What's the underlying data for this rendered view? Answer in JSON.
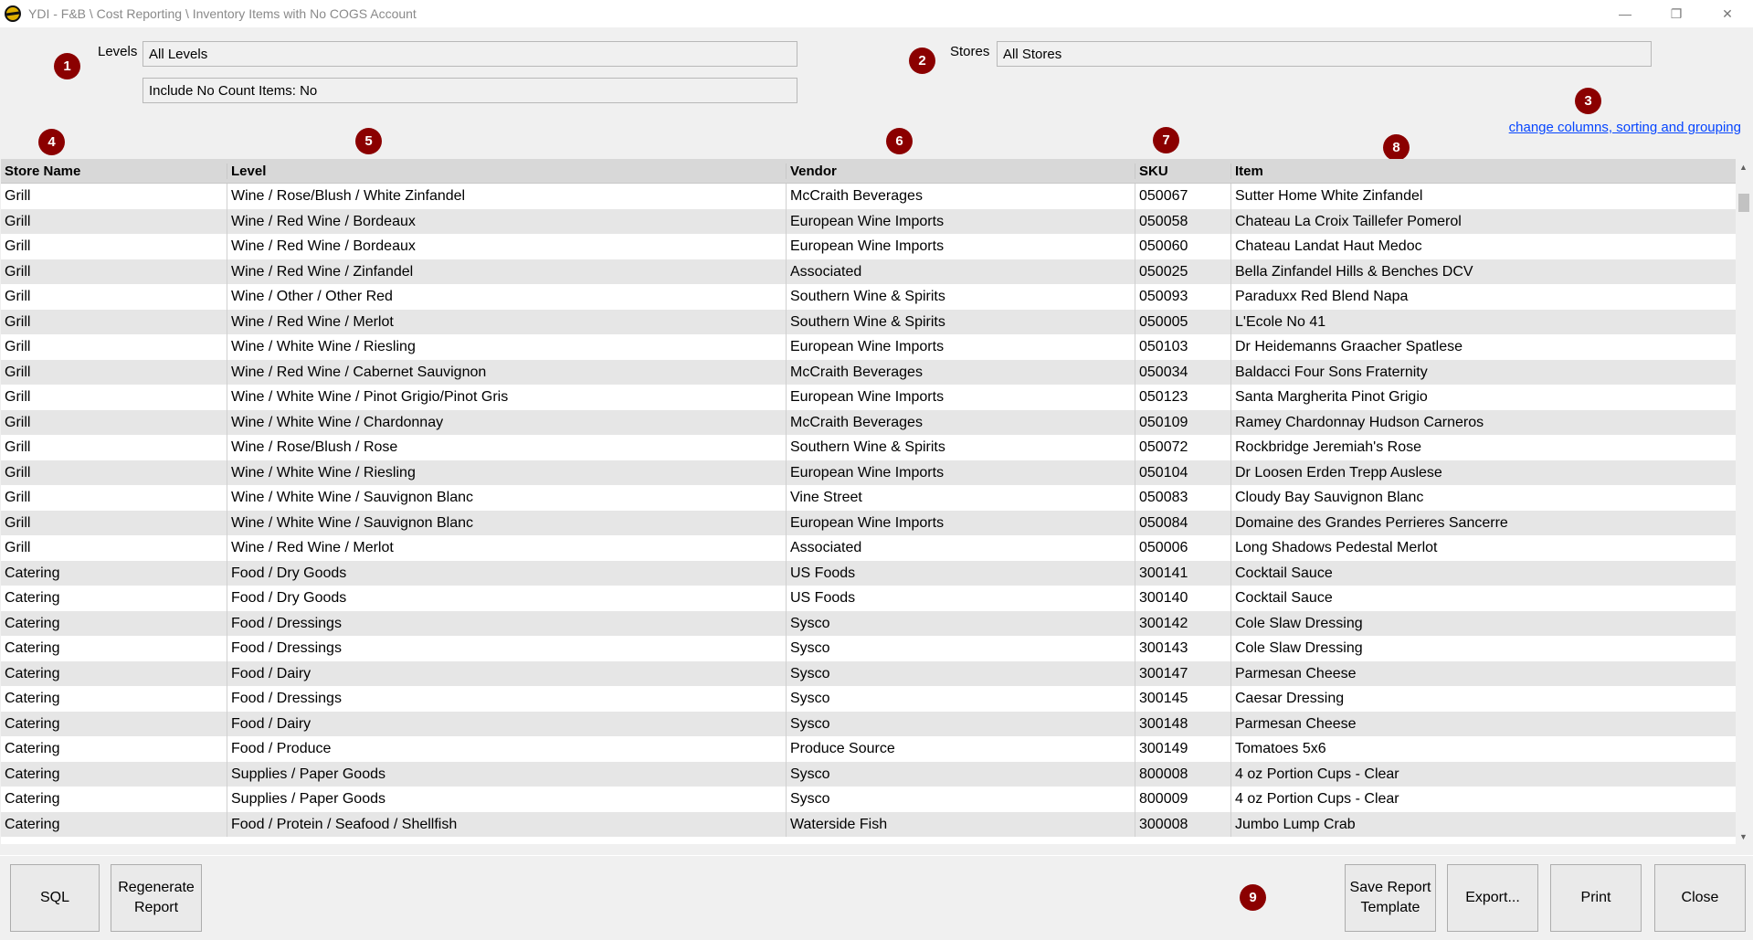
{
  "window": {
    "title": "YDI - F&B \\ Cost Reporting \\ Inventory Items with No COGS Account",
    "minimize_glyph": "—",
    "restore_glyph": "❐",
    "close_glyph": "✕"
  },
  "filters": {
    "levels_label": "Levels",
    "levels_value": "All Levels",
    "no_count_value": "Include No Count Items: No",
    "stores_label": "Stores",
    "stores_value": "All Stores"
  },
  "markers": [
    "1",
    "2",
    "3",
    "4",
    "5",
    "6",
    "7",
    "8",
    "9"
  ],
  "change_link": "change columns, sorting and grouping",
  "grid": {
    "headers": {
      "store": "Store Name",
      "level": "Level",
      "vendor": "Vendor",
      "sku": "SKU",
      "item": "Item"
    },
    "rows": [
      {
        "store": "Grill",
        "level": "Wine / Rose/Blush / White Zinfandel",
        "vendor": "McCraith Beverages",
        "sku": "050067",
        "item": "Sutter Home White Zinfandel"
      },
      {
        "store": "Grill",
        "level": "Wine / Red Wine / Bordeaux",
        "vendor": "European Wine Imports",
        "sku": "050058",
        "item": "Chateau La Croix Taillefer Pomerol"
      },
      {
        "store": "Grill",
        "level": "Wine / Red Wine / Bordeaux",
        "vendor": "European Wine Imports",
        "sku": "050060",
        "item": "Chateau Landat Haut Medoc"
      },
      {
        "store": "Grill",
        "level": "Wine / Red Wine / Zinfandel",
        "vendor": "Associated",
        "sku": "050025",
        "item": "Bella Zinfandel Hills & Benches DCV"
      },
      {
        "store": "Grill",
        "level": "Wine / Other / Other Red",
        "vendor": "Southern Wine & Spirits",
        "sku": "050093",
        "item": "Paraduxx  Red Blend Napa"
      },
      {
        "store": "Grill",
        "level": "Wine / Red Wine / Merlot",
        "vendor": "Southern Wine & Spirits",
        "sku": "050005",
        "item": "L'Ecole No 41"
      },
      {
        "store": "Grill",
        "level": "Wine / White Wine / Riesling",
        "vendor": "European Wine Imports",
        "sku": "050103",
        "item": "Dr Heidemanns Graacher Spatlese"
      },
      {
        "store": "Grill",
        "level": "Wine / Red Wine / Cabernet Sauvignon",
        "vendor": "McCraith Beverages",
        "sku": "050034",
        "item": "Baldacci Four Sons Fraternity"
      },
      {
        "store": "Grill",
        "level": "Wine / White Wine / Pinot Grigio/Pinot Gris",
        "vendor": "European Wine Imports",
        "sku": "050123",
        "item": "Santa Margherita Pinot Grigio"
      },
      {
        "store": "Grill",
        "level": "Wine / White Wine / Chardonnay",
        "vendor": "McCraith Beverages",
        "sku": "050109",
        "item": "Ramey Chardonnay Hudson Carneros"
      },
      {
        "store": "Grill",
        "level": "Wine / Rose/Blush / Rose",
        "vendor": "Southern Wine & Spirits",
        "sku": "050072",
        "item": "Rockbridge Jeremiah's Rose"
      },
      {
        "store": "Grill",
        "level": "Wine / White Wine / Riesling",
        "vendor": "European Wine Imports",
        "sku": "050104",
        "item": "Dr Loosen Erden Trepp Auslese"
      },
      {
        "store": "Grill",
        "level": "Wine / White Wine / Sauvignon Blanc",
        "vendor": "Vine Street",
        "sku": "050083",
        "item": "Cloudy Bay Sauvignon Blanc"
      },
      {
        "store": "Grill",
        "level": "Wine / White Wine / Sauvignon Blanc",
        "vendor": "European Wine Imports",
        "sku": "050084",
        "item": "Domaine des Grandes Perrieres Sancerre"
      },
      {
        "store": "Grill",
        "level": "Wine / Red Wine / Merlot",
        "vendor": "Associated",
        "sku": "050006",
        "item": "Long Shadows Pedestal Merlot"
      },
      {
        "store": "Catering",
        "level": "Food / Dry Goods",
        "vendor": "US Foods",
        "sku": "300141",
        "item": "Cocktail Sauce"
      },
      {
        "store": "Catering",
        "level": "Food / Dry Goods",
        "vendor": "US Foods",
        "sku": "300140",
        "item": "Cocktail Sauce"
      },
      {
        "store": "Catering",
        "level": "Food / Dressings",
        "vendor": "Sysco",
        "sku": "300142",
        "item": "Cole Slaw Dressing"
      },
      {
        "store": "Catering",
        "level": "Food / Dressings",
        "vendor": "Sysco",
        "sku": "300143",
        "item": "Cole Slaw Dressing"
      },
      {
        "store": "Catering",
        "level": "Food / Dairy",
        "vendor": "Sysco",
        "sku": "300147",
        "item": "Parmesan Cheese"
      },
      {
        "store": "Catering",
        "level": "Food / Dressings",
        "vendor": "Sysco",
        "sku": "300145",
        "item": "Caesar Dressing"
      },
      {
        "store": "Catering",
        "level": "Food / Dairy",
        "vendor": "Sysco",
        "sku": "300148",
        "item": "Parmesan Cheese"
      },
      {
        "store": "Catering",
        "level": "Food / Produce",
        "vendor": "Produce Source",
        "sku": "300149",
        "item": "Tomatoes 5x6"
      },
      {
        "store": "Catering",
        "level": "Supplies / Paper Goods",
        "vendor": "Sysco",
        "sku": "800008",
        "item": "4 oz Portion Cups - Clear"
      },
      {
        "store": "Catering",
        "level": "Supplies / Paper Goods",
        "vendor": "Sysco",
        "sku": "800009",
        "item": "4 oz Portion Cups - Clear"
      },
      {
        "store": "Catering",
        "level": "Food / Protein / Seafood / Shellfish",
        "vendor": "Waterside Fish",
        "sku": "300008",
        "item": "Jumbo Lump Crab"
      }
    ]
  },
  "buttons": {
    "sql": "SQL",
    "regenerate": "Regenerate Report",
    "save_template": "Save Report Template",
    "export": "Export...",
    "print": "Print",
    "close": "Close"
  }
}
